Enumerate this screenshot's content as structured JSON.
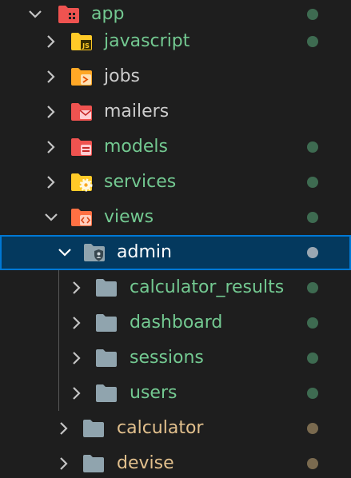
{
  "colors": {
    "background": "#1e1e1e",
    "selection_background": "#04395e",
    "selection_border": "#0078d4",
    "chevron": "#c5c5c5",
    "label_default": "#cccccc",
    "label_untracked": "#73c991",
    "label_selected": "#ffffff",
    "label_modified": "#e2c08d",
    "dot_untracked": "#3e6b51",
    "dot_selected": "#9aa7b2",
    "dot_modified": "#7a6a4f",
    "folder_grey": "#90a4ae",
    "folder_app": "#ef5350",
    "folder_javascript": "#ffca28",
    "folder_jobs": "#ffa726",
    "folder_mailers": "#ef5350",
    "folder_models": "#ef5350",
    "folder_services": "#ffca28",
    "folder_views": "#ff7043",
    "folder_admin": "#90a4ae"
  },
  "tree": {
    "app": {
      "label": "app",
      "icon": "app-folder-icon",
      "expanded": true
    },
    "javascript": {
      "label": "javascript",
      "icon": "javascript-folder-icon"
    },
    "jobs": {
      "label": "jobs",
      "icon": "jobs-folder-icon"
    },
    "mailers": {
      "label": "mailers",
      "icon": "mail-folder-icon"
    },
    "models": {
      "label": "models",
      "icon": "database-folder-icon"
    },
    "services": {
      "label": "services",
      "icon": "gear-folder-icon"
    },
    "views": {
      "label": "views",
      "icon": "code-folder-icon",
      "expanded": true
    },
    "admin": {
      "label": "admin",
      "icon": "shield-folder-icon",
      "expanded": true,
      "selected": true
    },
    "calculator_results": {
      "label": "calculator_results",
      "icon": "folder-icon"
    },
    "dashboard": {
      "label": "dashboard",
      "icon": "folder-icon"
    },
    "sessions": {
      "label": "sessions",
      "icon": "folder-icon"
    },
    "users": {
      "label": "users",
      "icon": "folder-icon"
    },
    "calculator": {
      "label": "calculator",
      "icon": "folder-icon"
    },
    "devise": {
      "label": "devise",
      "icon": "folder-icon"
    }
  }
}
